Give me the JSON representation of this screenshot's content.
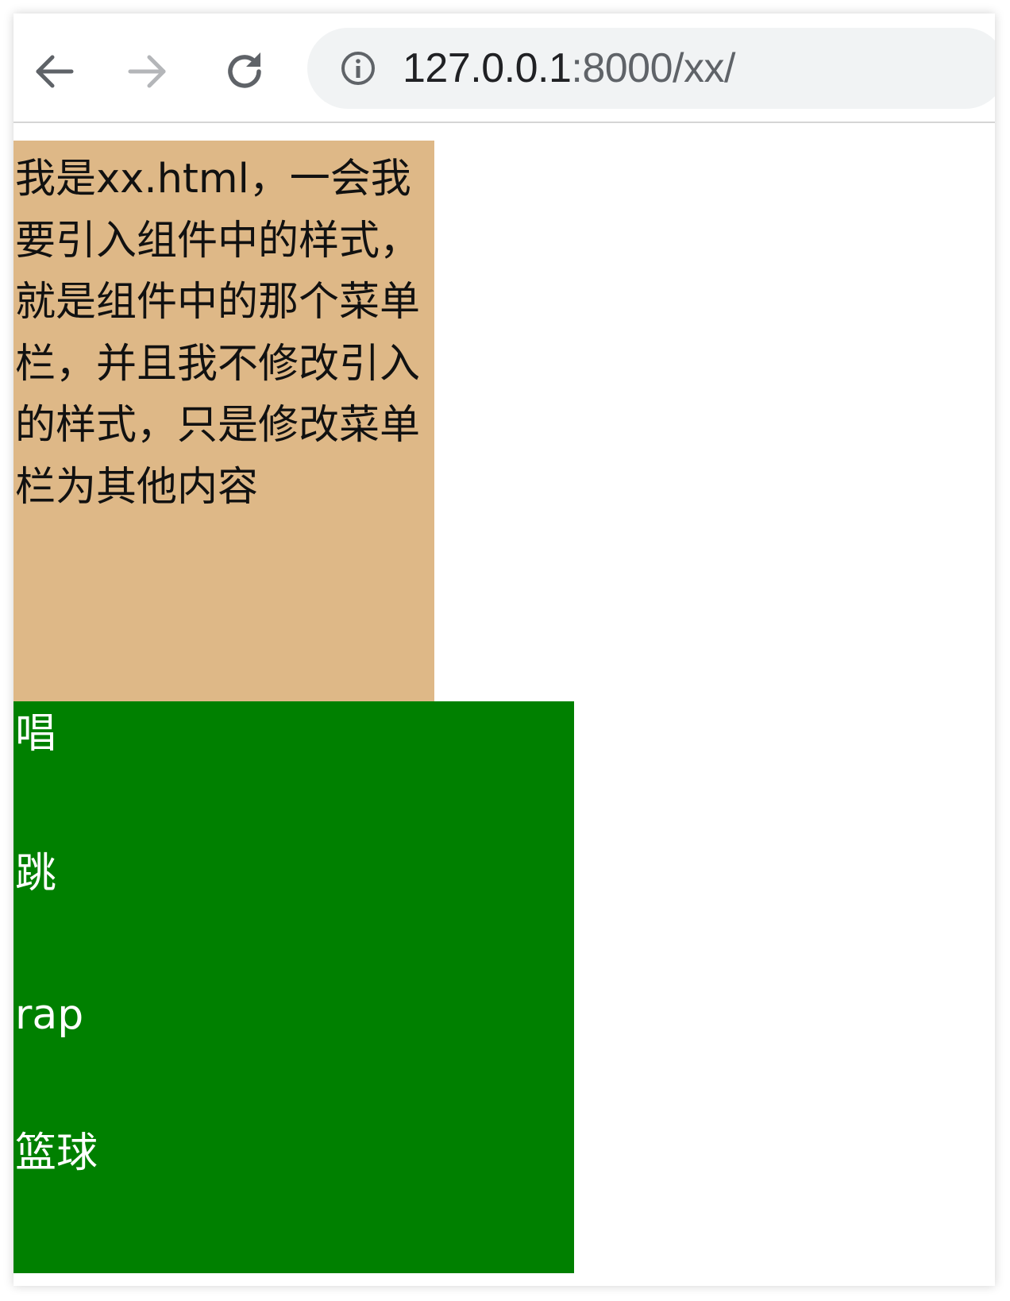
{
  "browser": {
    "url_host": "127.0.0.1",
    "url_rest": ":8000/xx/",
    "icons": {
      "back": "back-arrow-icon",
      "forward": "forward-arrow-icon",
      "reload": "reload-icon",
      "site_info": "info-icon"
    }
  },
  "page": {
    "intro_text": "我是xx.html，一会我要引入组件中的样式，就是组件中的那个菜单栏，并且我不修改引入的样式，只是修改菜单栏为其他内容",
    "intro_bg_color": "#deb887",
    "menu_bg_color": "#008000",
    "menu_items": [
      {
        "label": "唱"
      },
      {
        "label": "跳"
      },
      {
        "label": "rap"
      },
      {
        "label": "篮球"
      }
    ]
  }
}
